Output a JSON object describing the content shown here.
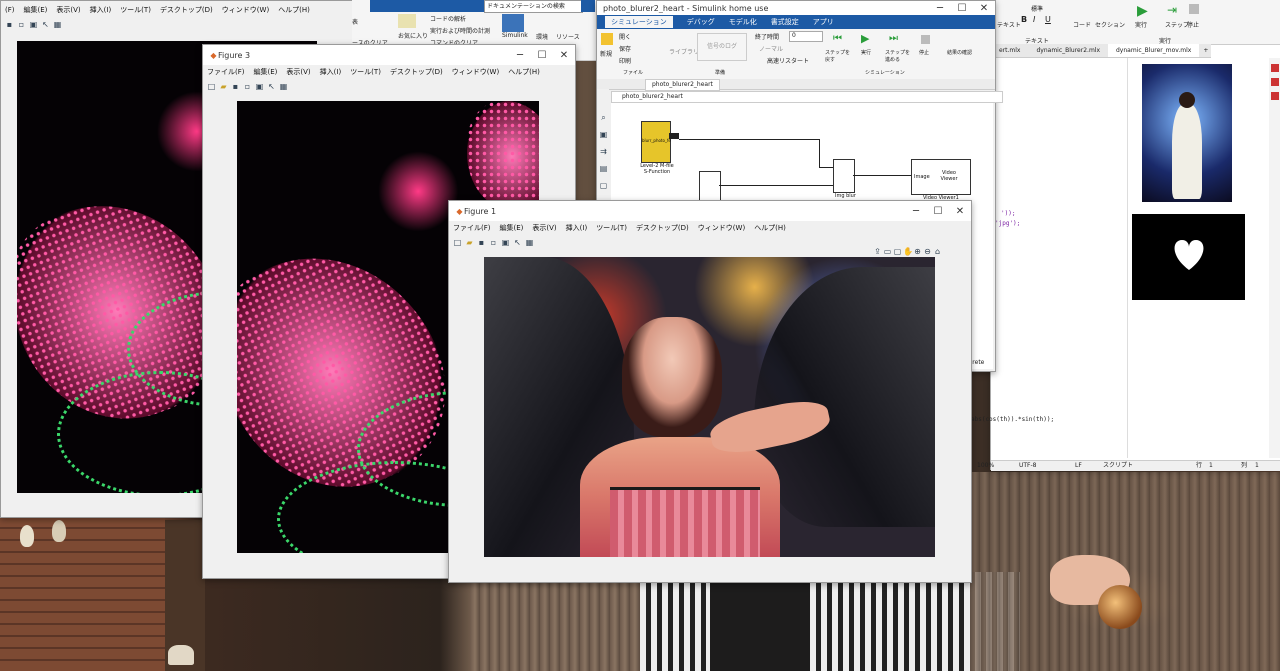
{
  "bg_windows": {
    "left_menu": [
      "(F)",
      "編集(E)",
      "表示(V)",
      "挿入(I)",
      "ツール(T)",
      "デスクトップ(D)",
      "ウィンドウ(W)",
      "ヘルプ(H)"
    ],
    "doc_search_placeholder": "ドキュメンテーションの検索",
    "mid_ribbon": {
      "items": [
        "表",
        "お気に入り",
        "コードの解析",
        "実行および時間の計測",
        "コマンドのクリア",
        "ースのクリア",
        "Simulink",
        "環境",
        "リソース"
      ]
    }
  },
  "figure3": {
    "title": "Figure 3",
    "menu": [
      "ファイル(F)",
      "編集(E)",
      "表示(V)",
      "挿入(I)",
      "ツール(T)",
      "デスクトップ(D)",
      "ウィンドウ(W)",
      "ヘルプ(H)"
    ]
  },
  "figure1": {
    "title": "Figure 1",
    "menu": [
      "ファイル(F)",
      "編集(E)",
      "表示(V)",
      "挿入(I)",
      "ツール(T)",
      "デスクトップ(D)",
      "ウィンドウ(W)",
      "ヘルプ(H)"
    ]
  },
  "simulink": {
    "title": "photo_blurer2_heart - Simulink home use",
    "tabs": [
      "シミュレーション",
      "デバッグ",
      "モデル化",
      "書式設定",
      "アプリ"
    ],
    "file_group": {
      "new": "新規",
      "open": "開く",
      "save": "保存",
      "print": "印刷",
      "label": "ファイル"
    },
    "library": "ライブラリ",
    "signal": "信号のログ",
    "prepare_label": "準備",
    "stop_time_label": "終了時間",
    "stop_time_value": "0",
    "mode_value": "ノーマル",
    "fast_restart": "高速リスタート",
    "step_back": "ステップを戻す",
    "run": "実行",
    "step_forward": "ステップを進める",
    "stop": "停止",
    "sim_label": "シミュレーション",
    "review": "結果の確認",
    "model_tab": "photo_blurer2_heart",
    "breadcrumb": "photo_blurer2_heart",
    "blocks": {
      "sfun": "Level-2 M-file S-Function",
      "sfun_inner": "blurr_photo_fe",
      "blur": "Img blur",
      "viewer_title": "Video Viewer",
      "viewer_label": "Video Viewer1",
      "viewer_port": "Image"
    },
    "footer_text": "crete"
  },
  "editor": {
    "tabs": [
      "ert.mlx",
      "dynamic_Blurer2.mlx",
      "dynamic_Blurer_mov.mlx"
    ],
    "ribbon_labels": [
      "テキスト",
      "標準",
      "コード",
      "セクション",
      "実行",
      "ステップ",
      "停止",
      "テキスト",
      "実行"
    ],
    "code_lines": [
      "'));",
      "'jpg');",
      "abs(cos(th)).*sin(th));"
    ],
    "status": [
      "100%",
      "UTF-8",
      "LF",
      "スクリプト",
      "行",
      "1",
      "列",
      "1"
    ]
  }
}
